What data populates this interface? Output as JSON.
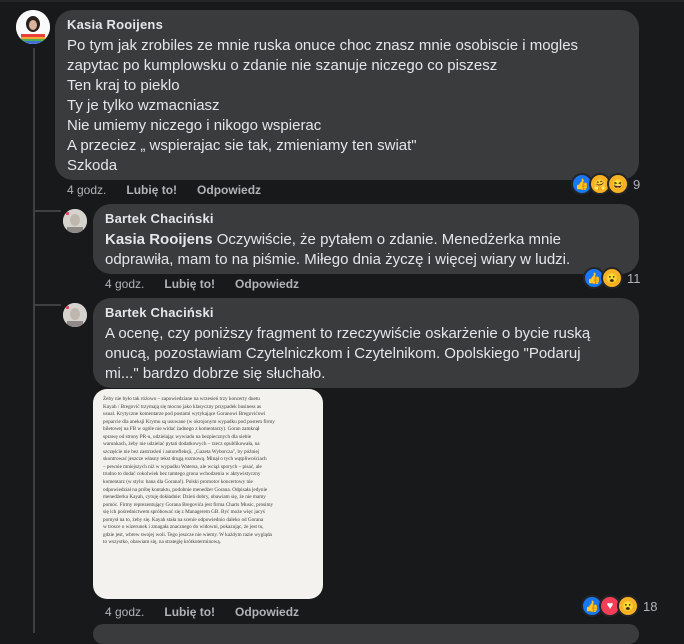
{
  "comments": [
    {
      "author": "Kasia Rooijens",
      "lines": [
        "Po tym jak zrobiles ze mnie ruska onuce choc znasz mnie osobiscie i mogles",
        "zapytac po kumplowsku o zdanie nie szanuje niczego co piszesz",
        "Ten kraj to pieklo",
        "Ty je tylko wzmacniasz",
        "Nie umiemy niczego i nikogo wspierac",
        "A przeciez „ wspierajac sie tak, zmieniamy ten swiat\"",
        "Szkoda"
      ],
      "time": "4 godz.",
      "like_label": "Lubię to!",
      "reply_label": "Odpowiedz",
      "reaction_count": "9",
      "reaction_icons": [
        "like-icon",
        "care-icon",
        "haha-icon"
      ]
    },
    {
      "author": "Bartek Chaciński",
      "mention": "Kasia Rooijens",
      "line1_rest": " Oczywiście, że pytałem o zdanie. Menedżerka mnie",
      "line2": "odprawiła, mam to na piśmie. Miłego dnia życzę i więcej wiary w ludzi.",
      "time": "4 godz.",
      "like_label": "Lubię to!",
      "reply_label": "Odpowiedz",
      "reaction_count": "11",
      "reaction_icons": [
        "like-icon",
        "wow-icon"
      ]
    },
    {
      "author": "Bartek Chaciński",
      "lines": [
        "A ocenę, czy poniższy fragment to rzeczywiście oskarżenie o bycie ruską",
        "onucą, pozostawiam Czytelniczkom i Czytelnikom. Opolskiego \"Podaruj",
        "mi...\" bardzo dobrze się słuchało."
      ],
      "attachment_lines": [
        "Żeby nie było tak różowo – zapowiedziane na wrzesień trzy koncerty duetu",
        "Kayah / Bregović trzymają się mocno jako klasyczny przypadek business as",
        "usual. Krytyczne komentarze pod postami wytykające Goranowi Bregovićowi",
        "poparcie dla aneksji Krymu są usuwane (w okrojonym wypadku pod postem firmy",
        "biletowej na FB w ogóle nie widać żadnego z komentarzy). Goran zamknął",
        "sprawę od strony PR-u, udzielając wywiadu na bezpiecznych dla siebie",
        "warunkach, żeby nie udzielać pytań dodatkowych – rzecz opublikowała, na",
        "szczęście nie bez zastrzeżeń i autorefleksji, „Gazeta Wyborcza\", by później",
        "skontrować jeszcze własny tekst drugą rozmową. Minął o tych wątpliwościach",
        "– pewnie mniejszych niż w wypadku Watersa, ale wciąż sporych – pisać, ale",
        "trudno to dodać cokolwiek bez tamtego grona wchodzenia w aktywistyczny",
        "komentarz (w stylu: bana dla Gorana!). Polski promotor koncertowy nie",
        "odpowiedział na próbę kontaktu, podobnie menedżer Gorana. Odpisała jedynie",
        "menedżerka Kayah, cytuję dokładnie: Dzień dobry, obawiam się, że nie mamy",
        "pomóc. Firmy reprezentujący Gorana Bregovića jest firma Charts Music, prosimy",
        "się ich pośrednictwem spróbować się z Managerem GB. Być może więc jacyś",
        "pomysł na to, żeby się. Kayah stała na scenie odpowiednio daleko od Gorana",
        "w trosce o wizerunek i zmagała znacznego do widowni, pokazując, że jest tu,",
        "gdzie jest, wbrew swojej woli. Tego jeszcze nie wiemy. W każdym razie wygląda",
        "to wszystko, obawiam się, na strategię krótkoterminową."
      ],
      "time": "4 godz.",
      "like_label": "Lubię to!",
      "reply_label": "Odpowiedz",
      "reaction_count": "18",
      "reaction_icons": [
        "like-icon",
        "love-icon",
        "wow-icon"
      ]
    }
  ]
}
